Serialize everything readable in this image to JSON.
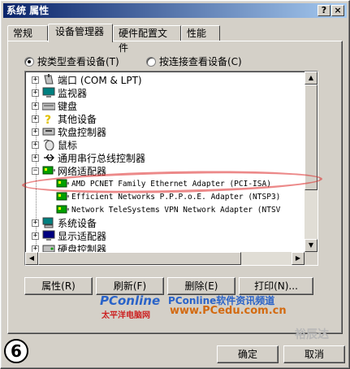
{
  "window": {
    "title": "系统 属性",
    "help_label": "?",
    "close_label": "×"
  },
  "tabs": [
    {
      "label": "常规"
    },
    {
      "label": "设备管理器"
    },
    {
      "label": "硬件配置文件"
    },
    {
      "label": "性能"
    }
  ],
  "view_options": {
    "by_type": "按类型查看设备(T)",
    "by_connection": "按连接查看设备(C)"
  },
  "tree": {
    "items": [
      {
        "label": "端口 (COM & LPT)",
        "icon": "port-icon",
        "expander": "+"
      },
      {
        "label": "监视器",
        "icon": "monitor-icon",
        "expander": "+"
      },
      {
        "label": "键盘",
        "icon": "keyboard-icon",
        "expander": "+"
      },
      {
        "label": "其他设备",
        "icon": "question-icon",
        "expander": "+"
      },
      {
        "label": "软盘控制器",
        "icon": "floppy-icon",
        "expander": "+"
      },
      {
        "label": "鼠标",
        "icon": "mouse-icon",
        "expander": "+"
      },
      {
        "label": "通用串行总线控制器",
        "icon": "usb-icon",
        "expander": "+"
      },
      {
        "label": "网络适配器",
        "icon": "network-icon",
        "expander": "−"
      },
      {
        "label": "AMD PCNET Family Ethernet Adapter (PCI-ISA)",
        "icon": "network-card-icon",
        "expander": ""
      },
      {
        "label": "Efficient Networks P.P.P.o.E. Adapter (NTSP3)",
        "icon": "network-card-icon",
        "expander": ""
      },
      {
        "label": "Network TeleSystems VPN Network Adapter (NTSV",
        "icon": "network-card-icon",
        "expander": ""
      },
      {
        "label": "系统设备",
        "icon": "system-icon",
        "expander": "+"
      },
      {
        "label": "显示适配器",
        "icon": "display-icon",
        "expander": "+"
      },
      {
        "label": "硬盘控制器",
        "icon": "disk-icon",
        "expander": "+"
      }
    ]
  },
  "buttons": {
    "properties": "属性(R)",
    "refresh": "刷新(F)",
    "remove": "删除(E)",
    "print": "打印(N)...",
    "ok": "确定",
    "cancel": "取消"
  },
  "watermark": {
    "brand": "PConline",
    "brand_cn": "太平洋电脑网",
    "channel": "PConline软件资讯频道",
    "url": "www.PCedu.com.cn",
    "corner": "裕辰达"
  },
  "step_number": "6"
}
